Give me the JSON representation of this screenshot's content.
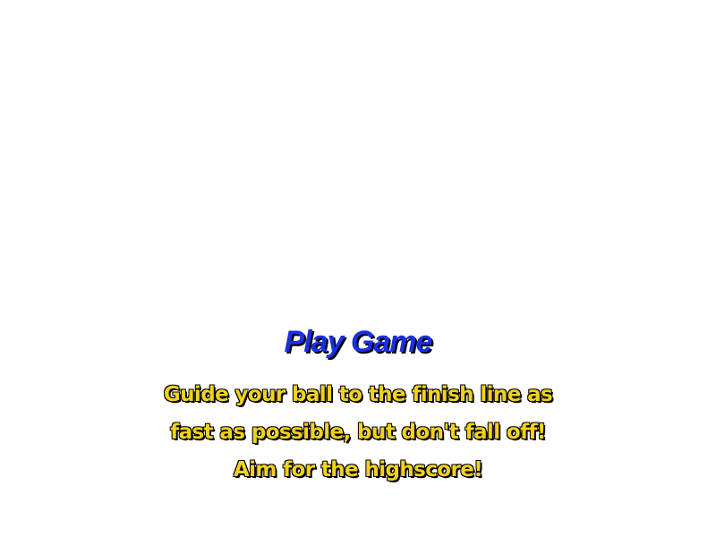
{
  "menu": {
    "play_label": "Play Game"
  },
  "description": {
    "lines": [
      "Guide your ball to the finish line as",
      "fast as possible, but don't fall off!",
      "Aim for the highscore!"
    ]
  },
  "colors": {
    "title": "#1a2fe0",
    "description": "#f2d21a",
    "shadow": "#000000",
    "background": "#ffffff"
  }
}
